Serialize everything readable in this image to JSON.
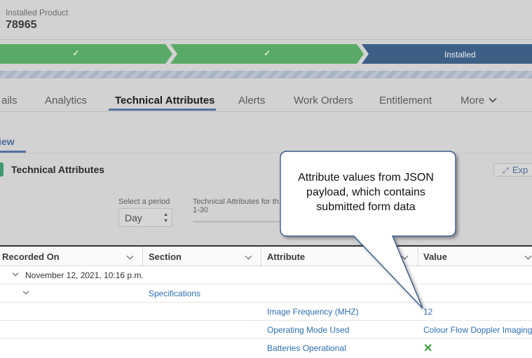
{
  "header": {
    "label": "Installed Product",
    "value": "78965"
  },
  "path": {
    "stages": [
      {
        "type": "complete",
        "icon": "check-icon",
        "glyph": "✓"
      },
      {
        "type": "complete",
        "icon": "check-icon",
        "glyph": "✓"
      },
      {
        "type": "current",
        "label": "Installed"
      }
    ],
    "colors": {
      "complete": "#5aaa67",
      "current": "#3d5f86"
    }
  },
  "tabs": {
    "items": [
      "ails",
      "Analytics",
      "Technical Attributes",
      "Alerts",
      "Work Orders",
      "Entitlement",
      "More"
    ],
    "active": "Technical Attributes"
  },
  "subtab": {
    "label": "iew"
  },
  "card": {
    "title": "Technical Attributes",
    "expand_label": "Exp",
    "period_label": "Select a period",
    "period_value": "Day",
    "ta_for_label": "Technical Attributes for th",
    "ta_for_range": "1-30"
  },
  "table": {
    "columns": [
      "Recorded On",
      "Section",
      "Attribute",
      "Value"
    ],
    "group_label": "November 12, 2021, 10:16 p.m.",
    "section": "Specifications",
    "rows": [
      {
        "attribute": "Image Frequency (MHZ)",
        "value": "12"
      },
      {
        "attribute": "Operating Mode Used",
        "value": "Colour Flow Doppler Imaging"
      },
      {
        "attribute": "Batteries Operational",
        "value_icon": "x-icon",
        "value_glyph": "✕"
      }
    ]
  },
  "callout": {
    "text": "Attribute values from JSON payload, which contains submitted form data"
  },
  "colors": {
    "link": "#2e6fb3",
    "accent": "#5372a0",
    "callout_border": "#3b5b8c",
    "false_icon": "#3fa33f"
  }
}
